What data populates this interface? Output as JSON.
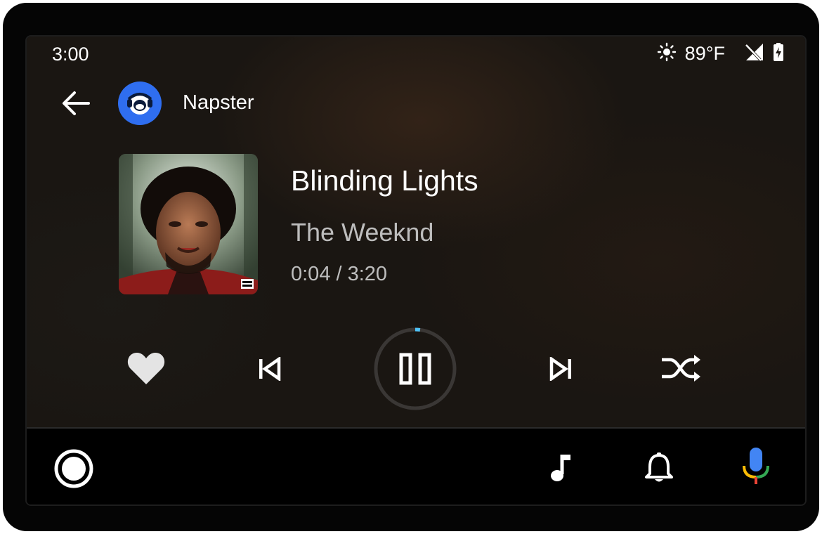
{
  "status_bar": {
    "time": "3:00",
    "temperature": "89°F",
    "weather_icon": "sun-icon",
    "signal_icon": "no-signal-icon",
    "battery_icon": "battery-charging-icon"
  },
  "header": {
    "back_icon": "back-arrow-icon",
    "app_icon": "napster-logo",
    "app_name": "Napster"
  },
  "now_playing": {
    "title": "Blinding Lights",
    "artist": "The Weeknd",
    "progress_text": "0:04 / 3:20",
    "progress_fraction": 0.02,
    "album_art_badge": "PARENTAL ADVISORY EXPLICIT CONTENT"
  },
  "controls": [
    {
      "name": "favorite-button",
      "icon": "heart-icon"
    },
    {
      "name": "previous-track-button",
      "icon": "skip-previous-icon"
    },
    {
      "name": "pause-button",
      "icon": "pause-icon"
    },
    {
      "name": "next-track-button",
      "icon": "skip-next-icon"
    },
    {
      "name": "shuffle-button",
      "icon": "shuffle-icon"
    }
  ],
  "nav_bar": {
    "items": [
      "home-icon",
      "music-note-icon",
      "bell-icon",
      "microphone-icon"
    ]
  },
  "colors": {
    "app_blue": "#2f6ef0",
    "progress_accent": "#4fc3f7",
    "mic_blue": "#4285f4",
    "mic_red": "#ea4335",
    "mic_yellow": "#fbbc05",
    "mic_green": "#34a853"
  }
}
